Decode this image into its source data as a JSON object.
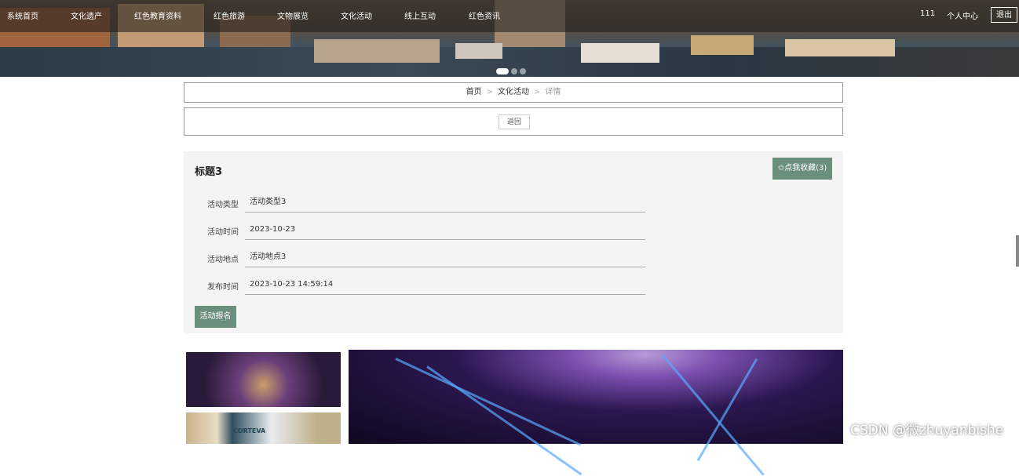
{
  "nav": {
    "items": [
      "系统首页",
      "文化遗产",
      "红色教育资料",
      "红色旅游",
      "文物展览",
      "文化活动",
      "线上互动",
      "红色资讯"
    ],
    "username": "111",
    "profile": "个人中心",
    "logout": "退出"
  },
  "breadcrumb": {
    "home": "首页",
    "category": "文化活动",
    "current": "详情",
    "sep": ">"
  },
  "back_label": "返回",
  "detail": {
    "title": "标题3",
    "favorite": "✩点我收藏(3)",
    "fields": [
      {
        "label": "活动类型",
        "value": "活动类型3"
      },
      {
        "label": "活动时间",
        "value": "2023-10-23"
      },
      {
        "label": "活动地点",
        "value": "活动地点3"
      },
      {
        "label": "发布时间",
        "value": "2023-10-23 14:59:14"
      }
    ],
    "signup": "活动报名"
  },
  "gallery": {
    "thumb2_logo": "CORTEVA"
  },
  "watermark": "CSDN @微zhuyanbishe",
  "colors": {
    "accent": "#6b8f7d",
    "nav_bg": "#191919"
  }
}
